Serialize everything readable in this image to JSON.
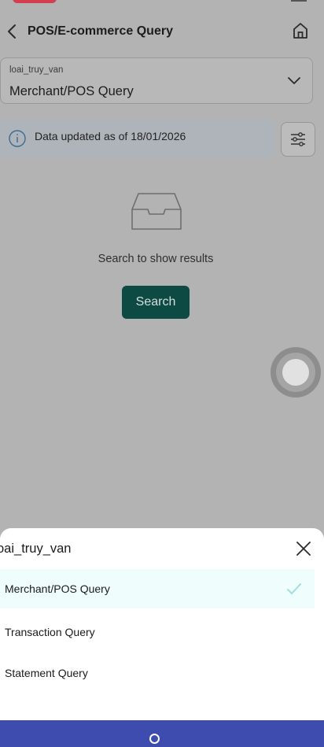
{
  "colors": {
    "overlay_bg": "#b3b3b4",
    "primary": "#0d4a44",
    "sheet_selected_bg": "#effdfd",
    "check": "#9ee0e0",
    "navbar": "#3d4cae"
  },
  "header": {
    "title": "POS/E-commerce Query",
    "back_icon": "chevron-left-icon",
    "home_icon": "home-icon"
  },
  "select": {
    "label": "loai_truy_van",
    "value": "Merchant/POS Query",
    "icon": "chevron-down-icon"
  },
  "info": {
    "text": "Data updated as of 18/01/2026",
    "icon": "info-icon",
    "filter_icon": "sliders-icon"
  },
  "empty_state": {
    "icon": "inbox-icon",
    "message": "Search to show results"
  },
  "search_button": {
    "label": "Search"
  },
  "sheet": {
    "title": "oai_truy_van",
    "close_icon": "close-icon",
    "options": [
      {
        "label": "Merchant/POS Query",
        "selected": true
      },
      {
        "label": "Transaction Query",
        "selected": false
      },
      {
        "label": "Statement Query",
        "selected": false
      }
    ]
  }
}
